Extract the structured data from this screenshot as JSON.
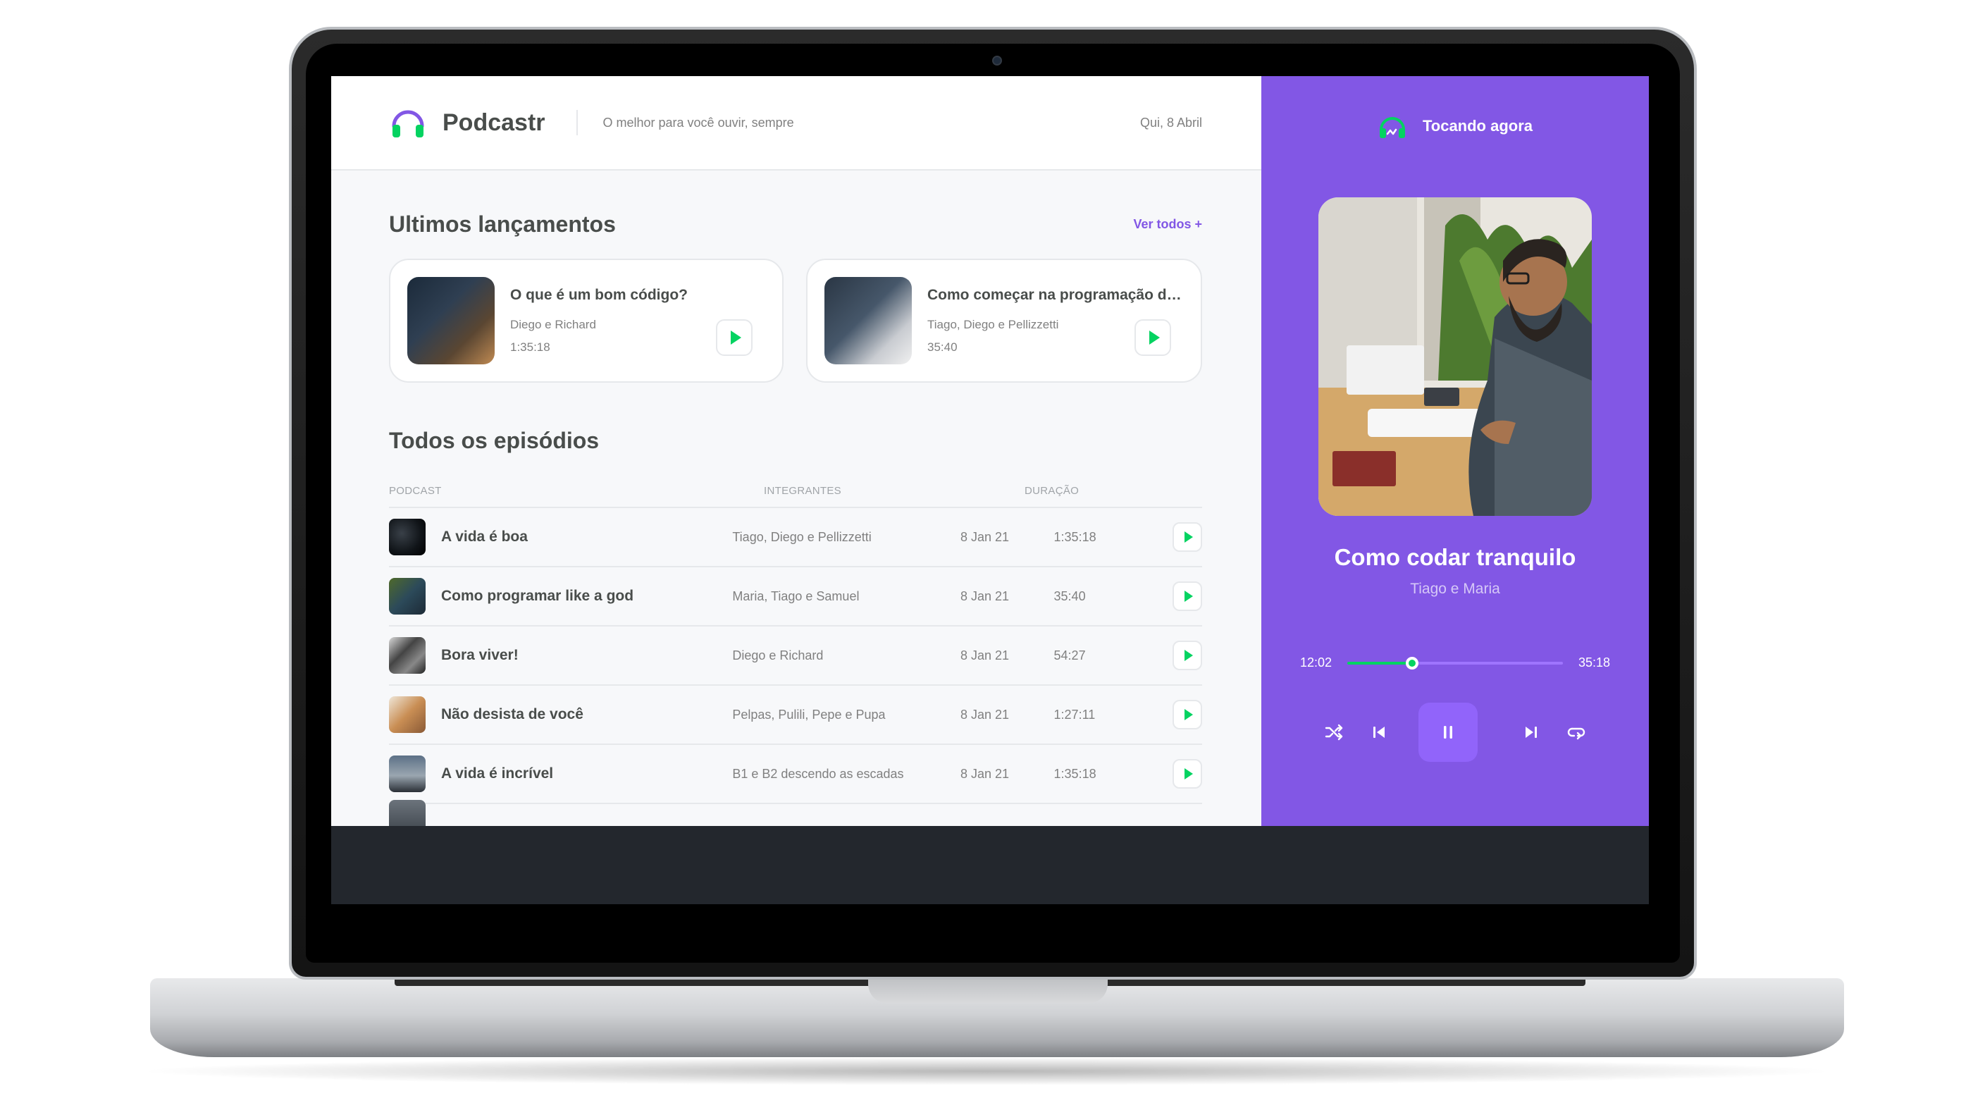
{
  "header": {
    "app_name": "Podcastr",
    "tagline": "O melhor para você ouvir, sempre",
    "date": "Qui, 8 Abril"
  },
  "latest": {
    "title": "Ultimos lançamentos",
    "see_all": "Ver todos +",
    "cards": [
      {
        "title": "O que é um bom código?",
        "members": "Diego e Richard",
        "duration": "1:35:18"
      },
      {
        "title": "Como começar na programação do jeito certo",
        "members": "Tiago, Diego e Pellizzetti",
        "duration": "35:40"
      }
    ]
  },
  "episodes": {
    "title": "Todos os episódios",
    "columns": {
      "podcast": "Podcast",
      "members": "Integrantes",
      "duration": "Duração"
    },
    "rows": [
      {
        "title": "A vida é boa",
        "members": "Tiago, Diego e Pellizzetti",
        "date": "8 Jan 21",
        "duration": "1:35:18"
      },
      {
        "title": "Como programar like a god",
        "members": "Maria, Tiago e Samuel",
        "date": "8 Jan 21",
        "duration": "35:40"
      },
      {
        "title": "Bora viver!",
        "members": "Diego e Richard",
        "date": "8 Jan 21",
        "duration": "54:27"
      },
      {
        "title": "Não desista de você",
        "members": "Pelpas, Pulili, Pepe e Pupa",
        "date": "8 Jan 21",
        "duration": "1:27:11"
      },
      {
        "title": "A vida é incrível",
        "members": "B1 e B2 descendo as escadas",
        "date": "8 Jan 21",
        "duration": "1:35:18"
      }
    ]
  },
  "player": {
    "header_label": "Tocando agora",
    "title": "Como codar tranquilo",
    "members": "Tiago e Maria",
    "elapsed": "12:02",
    "total": "35:18",
    "progress_fraction": 0.3
  },
  "colors": {
    "brand_purple": "#8257e5",
    "accent_green": "#04d361",
    "text_dark": "#494d4b",
    "text_muted": "#808080"
  },
  "icons": {
    "logo": "headphones-icon",
    "now_playing": "playing-headphones-icon",
    "play": "play-icon",
    "shuffle": "shuffle-icon",
    "previous": "previous-icon",
    "pause": "pause-icon",
    "next": "next-icon",
    "repeat": "repeat-icon"
  }
}
